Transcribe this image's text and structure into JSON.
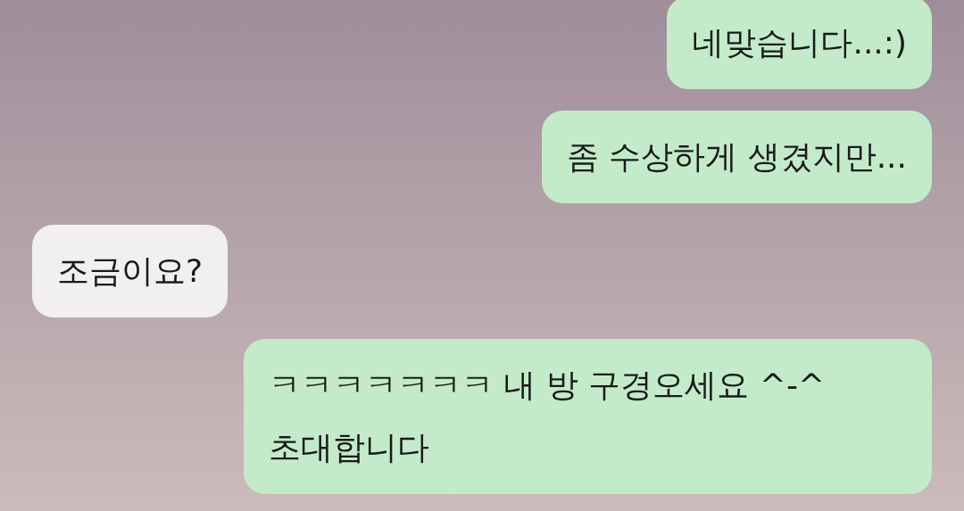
{
  "messages": [
    {
      "kind": "outgoing",
      "text": "네맞습니다...:)"
    },
    {
      "kind": "outgoing",
      "text": "좀 수상하게 생겼지만..."
    },
    {
      "kind": "incoming",
      "text": "조금이요?"
    },
    {
      "kind": "outgoing",
      "text": "ㅋㅋㅋㅋㅋㅋㅋ 내 방 구경오세요 ^-^초대합니다"
    }
  ]
}
